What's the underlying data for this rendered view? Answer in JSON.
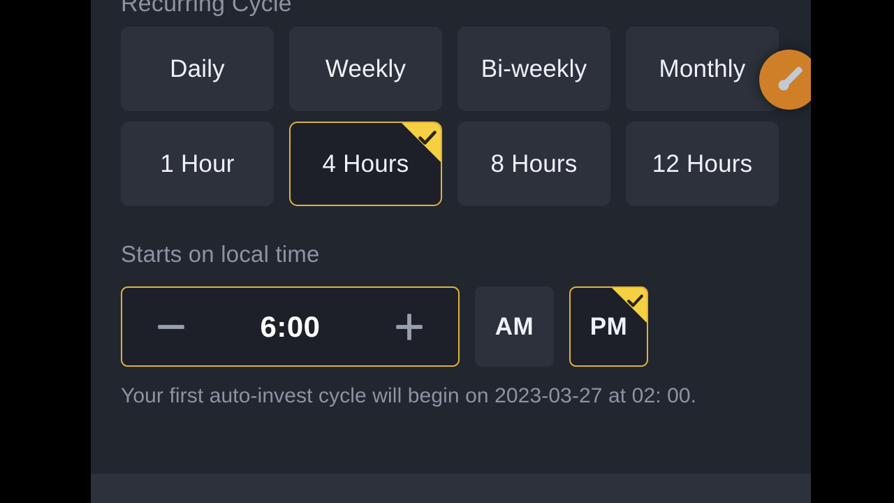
{
  "screen": {
    "background_color": "#22262f",
    "letterbox_color": "#000000",
    "accent_color": "#e0b13a",
    "badge_color": "#f5d042",
    "fab_color": "#cf7f28"
  },
  "recurring_cycle": {
    "title": "Recurring Cycle",
    "frequency_options": [
      {
        "label": "Daily",
        "selected": false
      },
      {
        "label": "Weekly",
        "selected": false
      },
      {
        "label": "Bi-weekly",
        "selected": false
      },
      {
        "label": "Monthly",
        "selected": false
      }
    ],
    "interval_options": [
      {
        "label": "1 Hour",
        "selected": false
      },
      {
        "label": "4 Hours",
        "selected": true
      },
      {
        "label": "8 Hours",
        "selected": false
      },
      {
        "label": "12 Hours",
        "selected": false
      }
    ]
  },
  "start_time": {
    "label": "Starts on local time",
    "decrement_icon": "minus-icon",
    "increment_icon": "plus-icon",
    "value": "6:00",
    "meridiem_options": [
      {
        "label": "AM",
        "selected": false
      },
      {
        "label": "PM",
        "selected": true
      }
    ]
  },
  "note": {
    "text": "Your first auto-invest cycle will begin on 2023-03-27 at 02: 00."
  },
  "fab": {
    "icon": "brush-icon"
  }
}
